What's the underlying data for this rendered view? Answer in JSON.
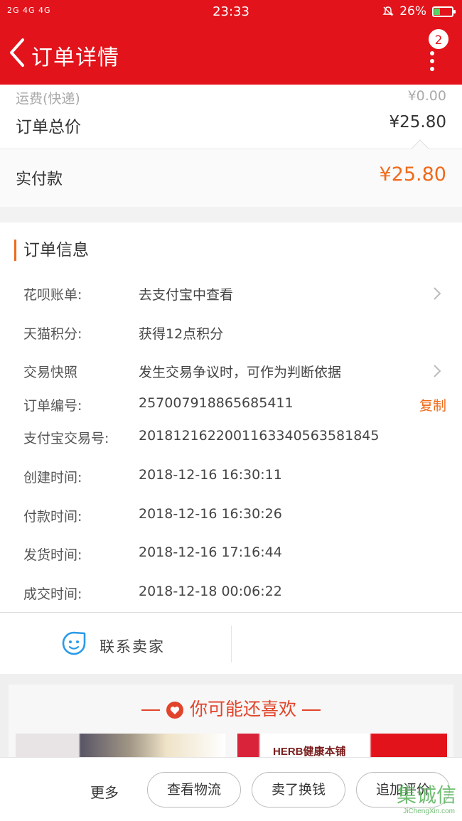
{
  "status_bar": {
    "signal": "2G 4G 4G",
    "time": "23:33",
    "battery": "26%"
  },
  "header": {
    "title": "订单详情",
    "badge_count": "2"
  },
  "price": {
    "shipping_label": "运费(快递)",
    "shipping_value": "¥0.00",
    "total_label": "订单总价",
    "total_value": "¥25.80",
    "paid_label": "实付款",
    "paid_value": "¥25.80"
  },
  "order_info": {
    "heading": "订单信息",
    "rows": [
      {
        "label": "花呗账单:",
        "value": "去支付宝中查看"
      },
      {
        "label": "天猫积分:",
        "value": "获得12点积分"
      },
      {
        "label": "交易快照",
        "value": "发生交易争议时，可作为判断依据"
      },
      {
        "label": "订单编号:",
        "value": "257007918865685411"
      },
      {
        "label": "支付宝交易号:",
        "value": "2018121622001163340563581845"
      },
      {
        "label": "创建时间:",
        "value": "2018-12-16 16:30:11"
      },
      {
        "label": "付款时间:",
        "value": "2018-12-16 16:30:26"
      },
      {
        "label": "发货时间:",
        "value": "2018-12-16 17:16:44"
      },
      {
        "label": "成交时间:",
        "value": "2018-12-18 00:06:22"
      }
    ],
    "copy_label": "复制"
  },
  "contact": {
    "label": "联系卖家"
  },
  "recommend": {
    "title": "你可能还喜欢",
    "item2_brand": "HERB健康本铺"
  },
  "bottom": {
    "more_label": "更多",
    "buttons": [
      "查看物流",
      "卖了换钱",
      "追加评价"
    ]
  },
  "watermark": {
    "glyphs": "集诚信",
    "site": "JiChengXin.com"
  },
  "colors": {
    "header_red": "#e2131b",
    "accent_orange": "#f06a1b"
  }
}
